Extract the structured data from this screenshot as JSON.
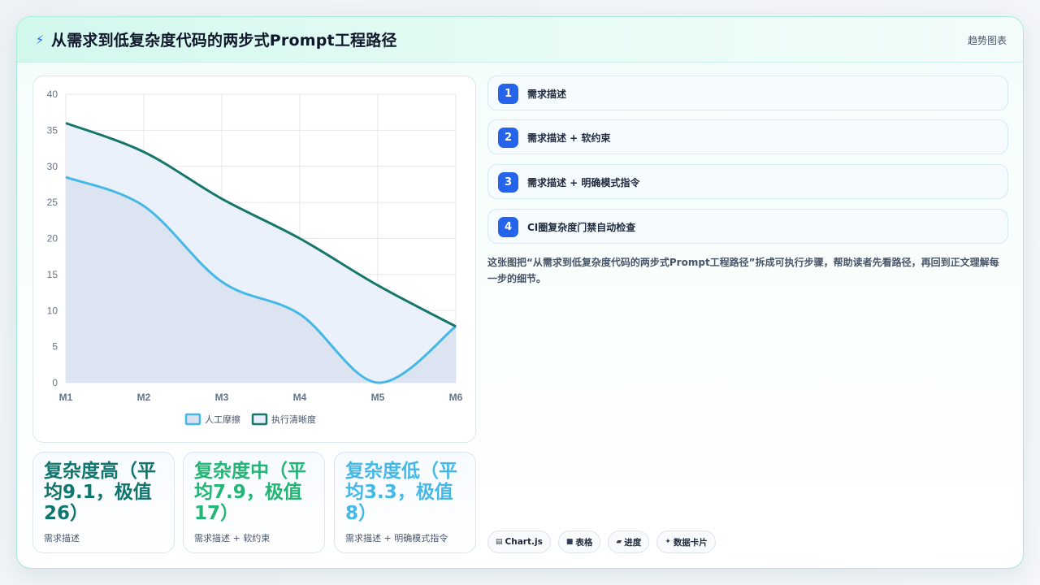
{
  "header": {
    "icon": "lightning-icon",
    "title": "从需求到低复杂度代码的两步式Prompt工程路径",
    "tag": "趋势图表"
  },
  "chart_data": {
    "type": "area",
    "categories": [
      "M1",
      "M2",
      "M3",
      "M4",
      "M5",
      "M6"
    ],
    "ylim": [
      0,
      40
    ],
    "yticks": [
      "0",
      "5",
      "10",
      "15",
      "20",
      "25",
      "30",
      "35",
      "40"
    ],
    "grid": true,
    "legend_position": "bottom",
    "series": [
      {
        "name": "人工摩擦",
        "values": [
          28.5,
          24.5,
          14,
          9.5,
          0,
          7.8
        ],
        "color": "#45b8e6",
        "fill": "#d9e2ee"
      },
      {
        "name": "执行清晰度",
        "values": [
          36,
          32,
          25.5,
          20,
          13.5,
          7.8
        ],
        "color": "#17766b",
        "fill": "#e8effb"
      }
    ]
  },
  "metrics": [
    {
      "value": "复杂度高（平均9.1，极值26）",
      "subtitle": "需求描述",
      "color": "#0f766e"
    },
    {
      "value": "复杂度中（平均7.9，极值17）",
      "subtitle": "需求描述 + 软约束",
      "color": "#22b573"
    },
    {
      "value": "复杂度低（平均3.3，极值8）",
      "subtitle": "需求描述 + 明确模式指令",
      "color": "#45b8e6"
    }
  ],
  "steps": [
    {
      "num": "1",
      "label": "需求描述"
    },
    {
      "num": "2",
      "label": "需求描述 + 软约束"
    },
    {
      "num": "3",
      "label": "需求描述 + 明确模式指令"
    },
    {
      "num": "4",
      "label": "CI圈复杂度门禁自动检查"
    }
  ],
  "description": "这张图把“从需求到低复杂度代码的两步式Prompt工程路径”拆成可执行步骤，帮助读者先看路径，再回到正文理解每一步的细节。",
  "chips": [
    {
      "icon": "▤",
      "icon_name": "chart-icon",
      "label": "Chart.js"
    },
    {
      "icon": "■",
      "icon_name": "table-icon",
      "label": "表格"
    },
    {
      "icon": "▰",
      "icon_name": "progress-icon",
      "label": "进度"
    },
    {
      "icon": "✦",
      "icon_name": "data-card-icon",
      "label": "数据卡片"
    }
  ]
}
